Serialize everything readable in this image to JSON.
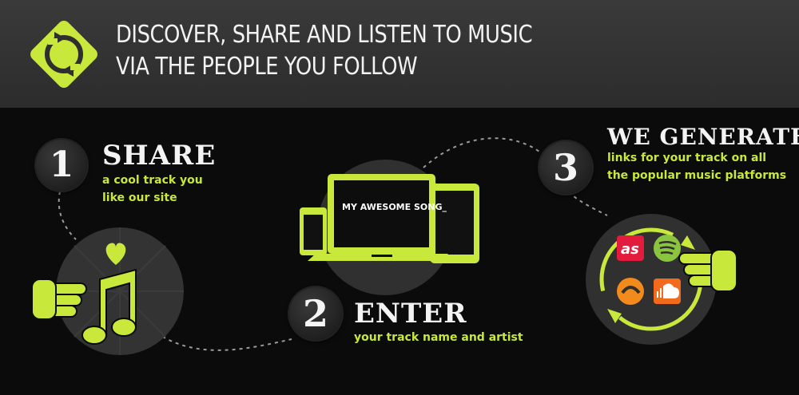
{
  "header": {
    "headline_line1": "DISCOVER, SHARE AND LISTEN TO MUSIC",
    "headline_line2": "VIA THE PEOPLE YOU FOLLOW",
    "logo_icon": "sync-arrows-icon"
  },
  "steps": [
    {
      "number": "1",
      "title": "SHARE",
      "sub_line1": "a cool track you",
      "sub_line2": "like our site"
    },
    {
      "number": "2",
      "title": "ENTER",
      "sub_line1": "your track name and artist"
    },
    {
      "number": "3",
      "title": "WE GENERATE",
      "sub_line1": "links for your track on all",
      "sub_line2": "the popular music platforms"
    }
  ],
  "laptop_screen_text": "MY AWESOME SONG_",
  "platform_icons": [
    "lastfm-icon",
    "spotify-icon",
    "grooveshark-icon",
    "soundcloud-icon"
  ],
  "colors": {
    "accent": "#c8e83b",
    "background": "#0b0b0b",
    "header": "#333333"
  }
}
